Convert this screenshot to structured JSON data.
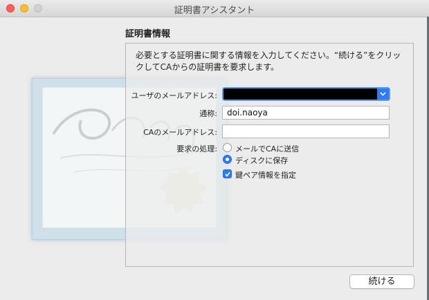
{
  "window": {
    "title": "証明書アシスタント"
  },
  "section": {
    "title": "証明書情報"
  },
  "intro": {
    "text": "必要とする証明書に関する情報を入力してください。“続ける”をクリックしてCAからの証明書を要求します。"
  },
  "form": {
    "email_label": "ユーザのメールアドレス:",
    "email_value": "",
    "common_name_label": "通称:",
    "common_name_value": "doi.naoya",
    "ca_email_label": "CAのメールアドレス:",
    "ca_email_value": "",
    "request_label": "要求の処理:",
    "options": [
      {
        "label": "メールでCAに送信",
        "selected": false
      },
      {
        "label": "ディスクに保存",
        "selected": true
      }
    ],
    "keypair_label": "鍵ペア情報を指定",
    "keypair_checked": true
  },
  "actions": {
    "continue_label": "続ける"
  },
  "colors": {
    "accent": "#2d7cf6",
    "close": "#fe5f57",
    "minimize": "#febc2e"
  }
}
